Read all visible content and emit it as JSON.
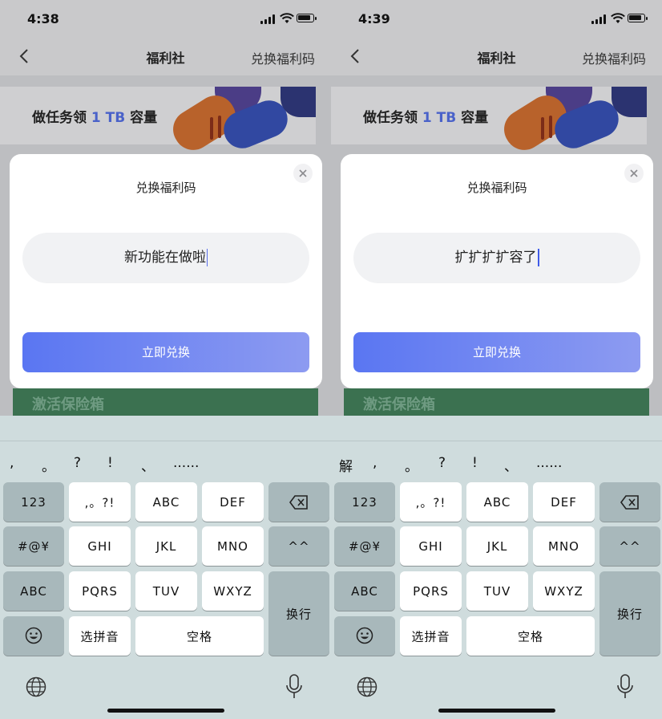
{
  "screens": [
    {
      "time": "4:38",
      "nav": {
        "title": "福利社",
        "right_link": "兑换福利码"
      },
      "banner": {
        "prefix": "做任务领 ",
        "highlight": "1 TB",
        "suffix": " 容量"
      },
      "behind_text": "激活保险箱",
      "modal": {
        "title": "兑换福利码",
        "input_value": "新功能在做啦",
        "button_label": "立即兑换"
      },
      "candidates": [
        ",",
        "。",
        "?",
        "!",
        "、",
        "......"
      ]
    },
    {
      "time": "4:39",
      "nav": {
        "title": "福利社",
        "right_link": "兑换福利码"
      },
      "banner": {
        "prefix": "做任务领 ",
        "highlight": "1 TB",
        "suffix": " 容量"
      },
      "behind_text": "激活保险箱",
      "modal": {
        "title": "兑换福利码",
        "input_value": "扩扩扩扩容了",
        "button_label": "立即兑换"
      },
      "candidates": [
        "解",
        ",",
        "。",
        "?",
        "!",
        "、",
        "......"
      ]
    }
  ],
  "keyboard": {
    "keys": {
      "num": "123",
      "punct": ",。?!",
      "abc": "ABC",
      "def": "DEF",
      "sym": "#@¥",
      "ghi": "GHI",
      "jkl": "JKL",
      "mno": "MNO",
      "caps": "^^",
      "abc_switch": "ABC",
      "pqrs": "PQRS",
      "tuv": "TUV",
      "wxyz": "WXYZ",
      "enter": "换行",
      "pinyin": "选拼音",
      "space": "空格"
    },
    "icons": [
      "backspace-icon",
      "emoji-icon",
      "globe-icon",
      "microphone-icon"
    ]
  },
  "colors": {
    "accent": "#5a76f2",
    "highlight": "#4a62c9",
    "keyboard_bg": "#cfdcdd"
  }
}
